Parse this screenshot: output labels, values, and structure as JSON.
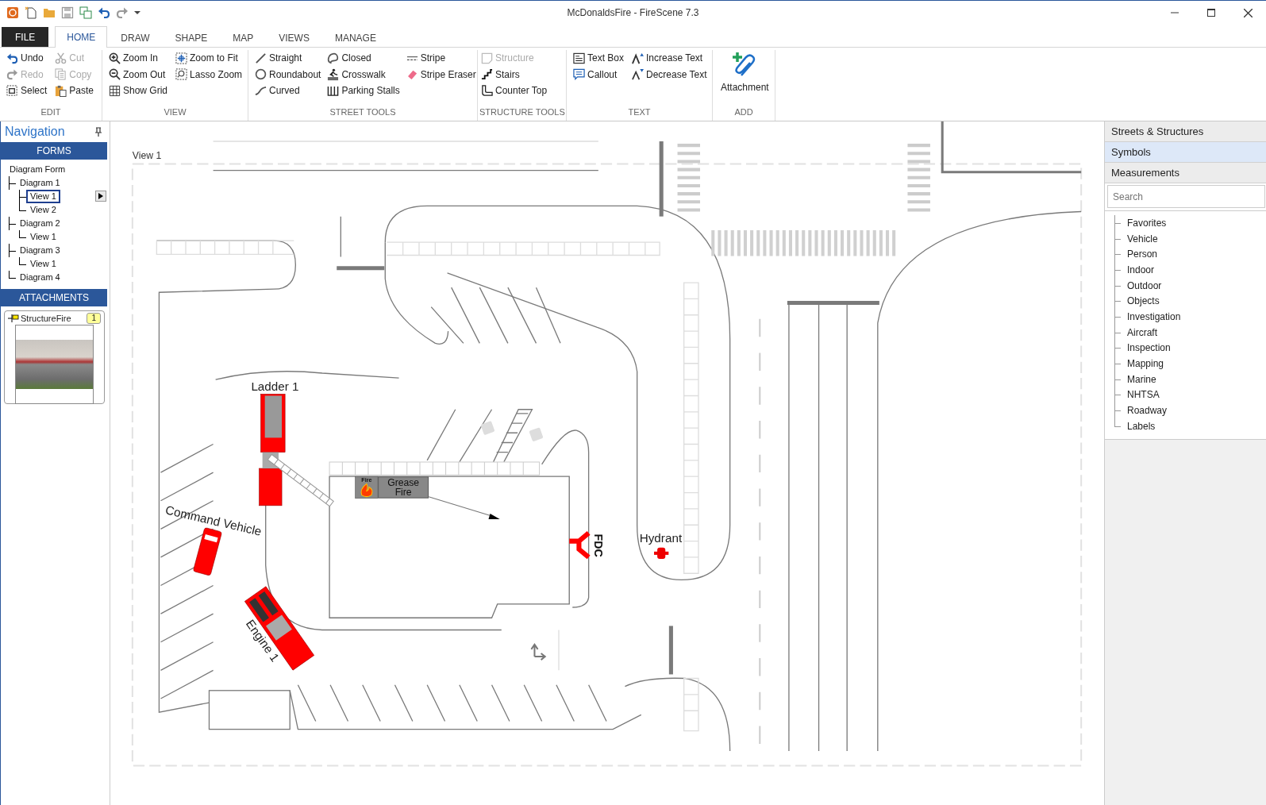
{
  "title_bar": {
    "title": "McDonaldsFire - FireScene 7.3"
  },
  "menu_tabs": [
    {
      "label": "FILE",
      "kind": "file",
      "selected": false
    },
    {
      "label": "HOME",
      "kind": "tab",
      "selected": true
    },
    {
      "label": "DRAW",
      "kind": "tab",
      "selected": false
    },
    {
      "label": "SHAPE",
      "kind": "tab",
      "selected": false
    },
    {
      "label": "MAP",
      "kind": "tab",
      "selected": false
    },
    {
      "label": "VIEWS",
      "kind": "tab",
      "selected": false
    },
    {
      "label": "MANAGE",
      "kind": "tab",
      "selected": false
    }
  ],
  "ribbon": {
    "groups": [
      {
        "label": "EDIT",
        "kind": "small",
        "columns": [
          [
            {
              "label": "Undo",
              "disabled": false
            },
            {
              "label": "Redo",
              "disabled": true
            },
            {
              "label": "Select",
              "disabled": false
            }
          ],
          [
            {
              "label": "Cut",
              "disabled": true
            },
            {
              "label": "Copy",
              "disabled": true
            },
            {
              "label": "Paste",
              "disabled": false
            }
          ]
        ]
      },
      {
        "label": "VIEW",
        "kind": "small",
        "columns": [
          [
            {
              "label": "Zoom In",
              "disabled": false
            },
            {
              "label": "Zoom Out",
              "disabled": false
            },
            {
              "label": "Show Grid",
              "disabled": false
            }
          ],
          [
            {
              "label": "Zoom to Fit",
              "disabled": false
            },
            {
              "label": "Lasso Zoom",
              "disabled": false
            }
          ]
        ]
      },
      {
        "label": "STREET TOOLS",
        "kind": "small",
        "columns": [
          [
            {
              "label": "Straight",
              "disabled": false
            },
            {
              "label": "Roundabout",
              "disabled": false
            },
            {
              "label": "Curved",
              "disabled": false
            }
          ],
          [
            {
              "label": "Closed",
              "disabled": false
            },
            {
              "label": "Crosswalk",
              "disabled": false
            },
            {
              "label": "Parking Stalls",
              "disabled": false
            }
          ],
          [
            {
              "label": "Stripe",
              "disabled": false
            },
            {
              "label": "Stripe Eraser",
              "disabled": false
            }
          ]
        ]
      },
      {
        "label": "STRUCTURE TOOLS",
        "kind": "small",
        "columns": [
          [
            {
              "label": "Structure",
              "disabled": true
            },
            {
              "label": "Stairs",
              "disabled": false
            },
            {
              "label": "Counter Top",
              "disabled": false
            }
          ]
        ]
      },
      {
        "label": "TEXT",
        "kind": "small",
        "columns": [
          [
            {
              "label": "Text Box",
              "disabled": false
            },
            {
              "label": "Callout",
              "disabled": false
            }
          ],
          [
            {
              "label": "Increase Text",
              "disabled": false
            },
            {
              "label": "Decrease Text",
              "disabled": false
            }
          ]
        ]
      },
      {
        "label": "ADD",
        "kind": "large",
        "columns": [
          [
            {
              "label": "Attachment",
              "disabled": false
            }
          ]
        ]
      }
    ]
  },
  "navigation": {
    "title": "Navigation",
    "forms_header": "FORMS",
    "forms_tree": [
      {
        "label": "Diagram Form",
        "selected": false,
        "children": [
          {
            "label": "Diagram 1",
            "selected": false,
            "children": [
              {
                "label": "View 1",
                "selected": true
              },
              {
                "label": "View 2",
                "selected": false
              }
            ]
          },
          {
            "label": "Diagram 2",
            "selected": false,
            "children": [
              {
                "label": "View 1",
                "selected": false
              }
            ]
          },
          {
            "label": "Diagram 3",
            "selected": false,
            "children": [
              {
                "label": "View 1",
                "selected": false
              }
            ]
          },
          {
            "label": "Diagram 4",
            "selected": false
          }
        ]
      }
    ],
    "attachments_header": "ATTACHMENTS",
    "attachments": [
      {
        "name": "StructureFire",
        "count": "1"
      }
    ]
  },
  "diagram": {
    "view_label": "View 1",
    "vehicles": [
      {
        "kind": "ladder",
        "label": "Ladder 1"
      },
      {
        "kind": "command",
        "label": "Command Vehicle"
      },
      {
        "kind": "engine",
        "label": "Engine 1"
      }
    ],
    "fire_marker": {
      "tag": "Fire",
      "label": "Grease Fire"
    },
    "fdc_label": "FDC",
    "hydrant_label": "Hydrant"
  },
  "symbol_panel": {
    "sections": [
      {
        "label": "Streets & Structures",
        "selected": false
      },
      {
        "label": "Symbols",
        "selected": true
      },
      {
        "label": "Measurements",
        "selected": false
      }
    ],
    "search": {
      "placeholder": "Search"
    },
    "categories": [
      "Favorites",
      "Vehicle",
      "Person",
      "Indoor",
      "Outdoor",
      "Objects",
      "Investigation",
      "Aircraft",
      "Inspection",
      "Mapping",
      "Marine",
      "NHTSA",
      "Roadway",
      "Labels"
    ]
  }
}
